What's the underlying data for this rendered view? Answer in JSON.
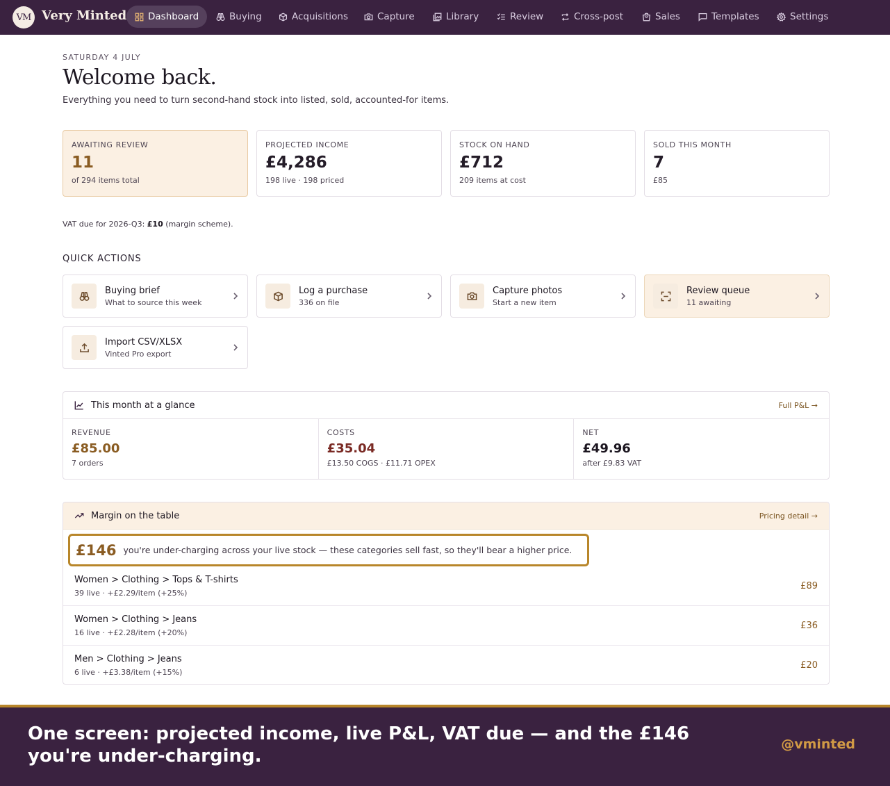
{
  "nav": {
    "logo_initials": "VM",
    "brand": "Very Minted",
    "items": [
      {
        "label": "Dashboard",
        "icon": "grid-icon",
        "active": true
      },
      {
        "label": "Buying",
        "icon": "binoculars-icon"
      },
      {
        "label": "Acquisitions",
        "icon": "box-icon"
      },
      {
        "label": "Capture",
        "icon": "camera-icon"
      },
      {
        "label": "Library",
        "icon": "images-icon"
      },
      {
        "label": "Review",
        "icon": "checklist-icon"
      },
      {
        "label": "Cross-post",
        "icon": "repeat-icon"
      },
      {
        "label": "Sales",
        "icon": "bag-icon"
      },
      {
        "label": "Templates",
        "icon": "message-icon"
      },
      {
        "label": "Settings",
        "icon": "gear-icon"
      }
    ]
  },
  "header": {
    "date": "SATURDAY 4 JULY",
    "title": "Welcome back.",
    "subtitle": "Everything you need to turn second-hand stock into listed, sold, accounted-for items."
  },
  "stats": [
    {
      "label": "AWAITING REVIEW",
      "value": "11",
      "sub": "of 294 items total"
    },
    {
      "label": "PROJECTED INCOME",
      "value": "£4,286",
      "sub": "198 live · 198 priced"
    },
    {
      "label": "STOCK ON HAND",
      "value": "£712",
      "sub": "209 items at cost"
    },
    {
      "label": "SOLD THIS MONTH",
      "value": "7",
      "sub": "£85"
    }
  ],
  "vat": {
    "prefix": "VAT due for 2026-Q3: ",
    "amount": "£10",
    "suffix": " (margin scheme)."
  },
  "quick_actions": {
    "heading": "QUICK ACTIONS",
    "items": [
      {
        "title": "Buying brief",
        "sub": "What to source this week",
        "icon": "binoculars-icon"
      },
      {
        "title": "Log a purchase",
        "sub": "336 on file",
        "icon": "box-icon"
      },
      {
        "title": "Capture photos",
        "sub": "Start a new item",
        "icon": "camera-icon"
      },
      {
        "title": "Review queue",
        "sub": "11 awaiting",
        "icon": "scan-icon"
      },
      {
        "title": "Import CSV/XLSX",
        "sub": "Vinted Pro export",
        "icon": "upload-icon"
      }
    ]
  },
  "glance": {
    "title": "This month at a glance",
    "link": "Full P&L →",
    "metrics": [
      {
        "label": "REVENUE",
        "value": "£85.00",
        "sub": "7 orders",
        "color": "#8a5c22"
      },
      {
        "label": "COSTS",
        "value": "£35.04",
        "sub": "£13.50 COGS · £11.71 OPEX",
        "color": "#7a2a24"
      },
      {
        "label": "NET",
        "value": "£49.96",
        "sub": "after £9.83 VAT",
        "color": "#1c1620"
      }
    ]
  },
  "margin": {
    "title": "Margin on the table",
    "link": "Pricing detail →",
    "amount": "£146",
    "message": "you're under-charging across your live stock — these categories sell fast, so they'll bear a higher price.",
    "rows": [
      {
        "category": "Women > Clothing > Tops & T-shirts",
        "detail": "39 live · +£2.29/item (+25%)",
        "amount": "£89"
      },
      {
        "category": "Women > Clothing > Jeans",
        "detail": "16 live · +£2.28/item (+20%)",
        "amount": "£36"
      },
      {
        "category": "Men > Clothing > Jeans",
        "detail": "6 live · +£3.38/item (+15%)",
        "amount": "£20"
      }
    ]
  },
  "banner": {
    "text": "One screen: projected income, live P&L, VAT due — and the £146 you're under-charging.",
    "handle": "@vminted"
  },
  "colors": {
    "nav_bg": "#3a2240",
    "accent": "#b8862a",
    "highlight_bg": "#fbf0e3"
  }
}
